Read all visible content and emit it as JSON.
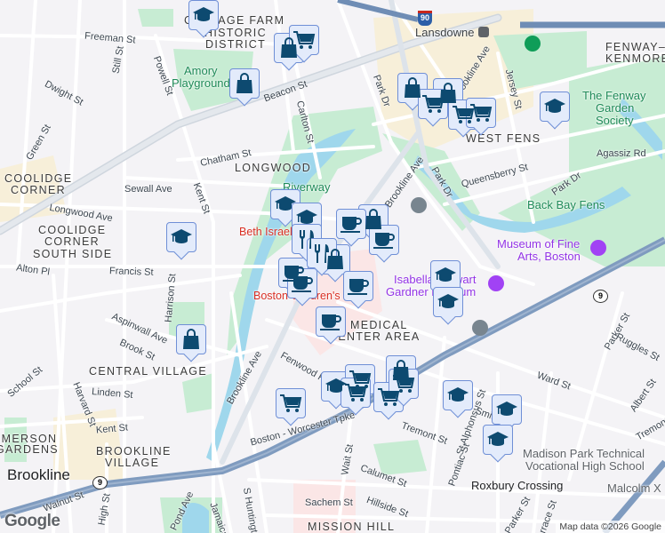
{
  "map": {
    "attribution": "Map data ©2026 Google",
    "logo": "Google",
    "shields": {
      "interstate": "90",
      "route": "9"
    },
    "areas": [
      "COTTAGE FARM",
      "HISTORIC",
      "DISTRICT",
      "LONGWOOD",
      "COOLIDGE",
      "CORNER",
      "COOLIDGE",
      "CORNER",
      "SOUTH SIDE",
      "CENTRAL VILLAGE",
      "EMERSON",
      "GARDENS",
      "BROOKLINE",
      "VILLAGE",
      "MEDICAL",
      "CENTER AREA",
      "WEST FENS",
      "FENWAY–",
      "KENMORE",
      "MISSION HILL"
    ],
    "places": {
      "brookline": "Brookline",
      "lansdowne": "Lansdowne",
      "roxbury": "Roxbury Crossing",
      "madison1": "Madison Park Technical",
      "madison2": "Vocational High School"
    },
    "parks": [
      "Amory",
      "Playground",
      "Riverway",
      "The Fenway",
      "Garden",
      "Society",
      "Back Bay Fens"
    ],
    "pois": {
      "beth_israel": "Beth Israel",
      "childrens": "Boston Children's",
      "isabella1": "Isabella Stewart",
      "isabella2": "Gardner Museum",
      "mfa1": "Museum of Fine",
      "mfa2": "Arts, Boston"
    },
    "streets": [
      "Freeman St",
      "Still St",
      "Powell St",
      "Dwight St",
      "Beacon St",
      "Carlton St",
      "Green St",
      "Chatham St",
      "Sewall Ave",
      "Kent St",
      "Longwood Ave",
      "Alton Pl",
      "Francis St",
      "Harrison St",
      "Aspinwall Ave",
      "Brook St",
      "School St",
      "Harvard St",
      "Linden St",
      "Kent St",
      "Brookline Ave",
      "Fenwood Rd",
      "Boston - Worcester Tpke",
      "Walnut St",
      "High St",
      "Pond Ave",
      "Jamaica",
      "S Huntington",
      "Park Dr",
      "Brookline Ave",
      "Jersey St",
      "Agassiz Rd",
      "Brookline Ave",
      "Park Dr",
      "Queensberry St",
      "Park Dr",
      "Ward St",
      "Parker St",
      "Ruggles St",
      "Albert St",
      "Tremont St",
      "St Alphonsus St",
      "Smith",
      "Wait St",
      "Pontiac St",
      "Calumet St",
      "Hillside St",
      "Sachem St",
      "Parker St",
      "Terrace St",
      "Tremont",
      "Malcolm X"
    ],
    "markers": [
      "school",
      "school",
      "school",
      "school",
      "school",
      "school",
      "school",
      "school",
      "school",
      "school",
      "school",
      "shopping",
      "shopping",
      "shopping",
      "shopping",
      "shopping",
      "shopping",
      "shopping",
      "shopping",
      "grocery",
      "grocery",
      "grocery",
      "grocery",
      "grocery",
      "grocery",
      "grocery",
      "grocery",
      "grocery",
      "cafe",
      "cafe",
      "cafe",
      "cafe",
      "cafe",
      "cafe",
      "restaurant",
      "restaurant"
    ],
    "colors": {
      "marker_fill": "#e3ebfb",
      "marker_border": "#6f8fd6",
      "icon": "#0d4a70",
      "park": "#c7ecd3",
      "water": "#9fd7ec",
      "highway": "#7f9bbf"
    }
  }
}
